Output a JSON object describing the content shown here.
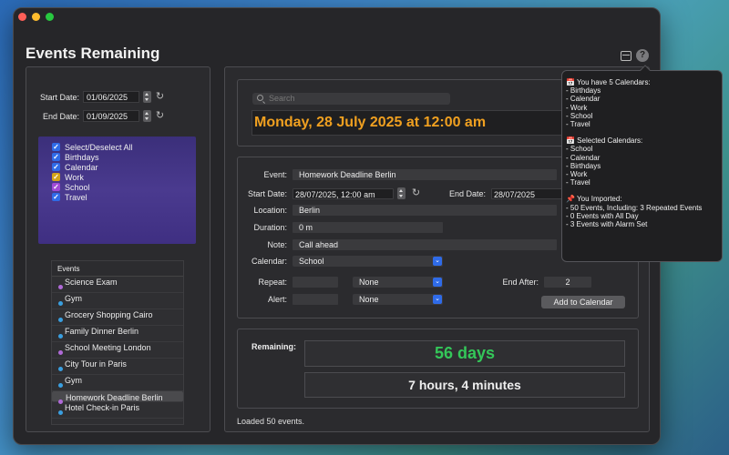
{
  "app": {
    "title": "Events Remaining"
  },
  "colors": {
    "accent": "#2f6be8",
    "date_text": "#f0a020",
    "days_text": "#34c759",
    "dot_purple": "#b06ad8",
    "dot_blue": "#3a9fe0"
  },
  "dates": {
    "start_label": "Start Date:",
    "start_value": "01/06/2025",
    "end_label": "End Date:",
    "end_value": "01/09/2025"
  },
  "calendars": [
    {
      "label": "Select/Deselect All",
      "color": "blue"
    },
    {
      "label": "Birthdays",
      "color": "blue"
    },
    {
      "label": "Calendar",
      "color": "blue"
    },
    {
      "label": "Work",
      "color": "yellow"
    },
    {
      "label": "School",
      "color": "purple"
    },
    {
      "label": "Travel",
      "color": "blue"
    }
  ],
  "events": {
    "header": "Events",
    "items": [
      {
        "name": "Science Exam",
        "dot": "purple"
      },
      {
        "name": "Gym",
        "dot": "blue"
      },
      {
        "name": "Grocery Shopping Cairo",
        "dot": "blue"
      },
      {
        "name": "Family Dinner Berlin",
        "dot": "blue"
      },
      {
        "name": "School Meeting London",
        "dot": "purple"
      },
      {
        "name": "City Tour in Paris",
        "dot": "blue"
      },
      {
        "name": "Gym",
        "dot": "blue"
      },
      {
        "name": "Homework Deadline Berlin",
        "dot": "purple",
        "selected": true
      },
      {
        "name": "Hotel Check-in Paris",
        "dot": "blue"
      }
    ]
  },
  "search": {
    "placeholder": "Search"
  },
  "current_datetime": "Monday, 28 July 2025 at 12:00 am",
  "form": {
    "event_label": "Event:",
    "event_value": "Homework Deadline Berlin",
    "start_label": "Start Date:",
    "start_value": "28/07/2025, 12:00 am",
    "end_label": "End Date:",
    "end_value": "28/07/2025",
    "location_label": "Location:",
    "location_value": "Berlin",
    "duration_label": "Duration:",
    "duration_value": "0 m",
    "note_label": "Note:",
    "note_value": "Call ahead",
    "calendar_label": "Calendar:",
    "calendar_value": "School",
    "repeat_label": "Repeat:",
    "repeat_value": "None",
    "alert_label": "Alert:",
    "alert_value": "None",
    "end_after_label": "End After:",
    "end_after_value": "2",
    "add_button": "Add to Calendar"
  },
  "remaining": {
    "label": "Remaining:",
    "days": "56 days",
    "hours": "7 hours, 4 minutes"
  },
  "status": "Loaded 50 events.",
  "tooltip": {
    "calendars_title": "📅 You have 5 Calendars:",
    "calendars": [
      "- Birthdays",
      "- Calendar",
      "- Work",
      "- School",
      "- Travel"
    ],
    "selected_title": "📅 Selected Calendars:",
    "selected": [
      "- School",
      "- Calendar",
      "- Birthdays",
      "- Work",
      "- Travel"
    ],
    "imported_title": "📌 You Imported:",
    "imported": [
      "- 50 Events, Including: 3 Repeated Events",
      "- 0 Events with All Day",
      "- 3 Events with Alarm Set"
    ]
  }
}
